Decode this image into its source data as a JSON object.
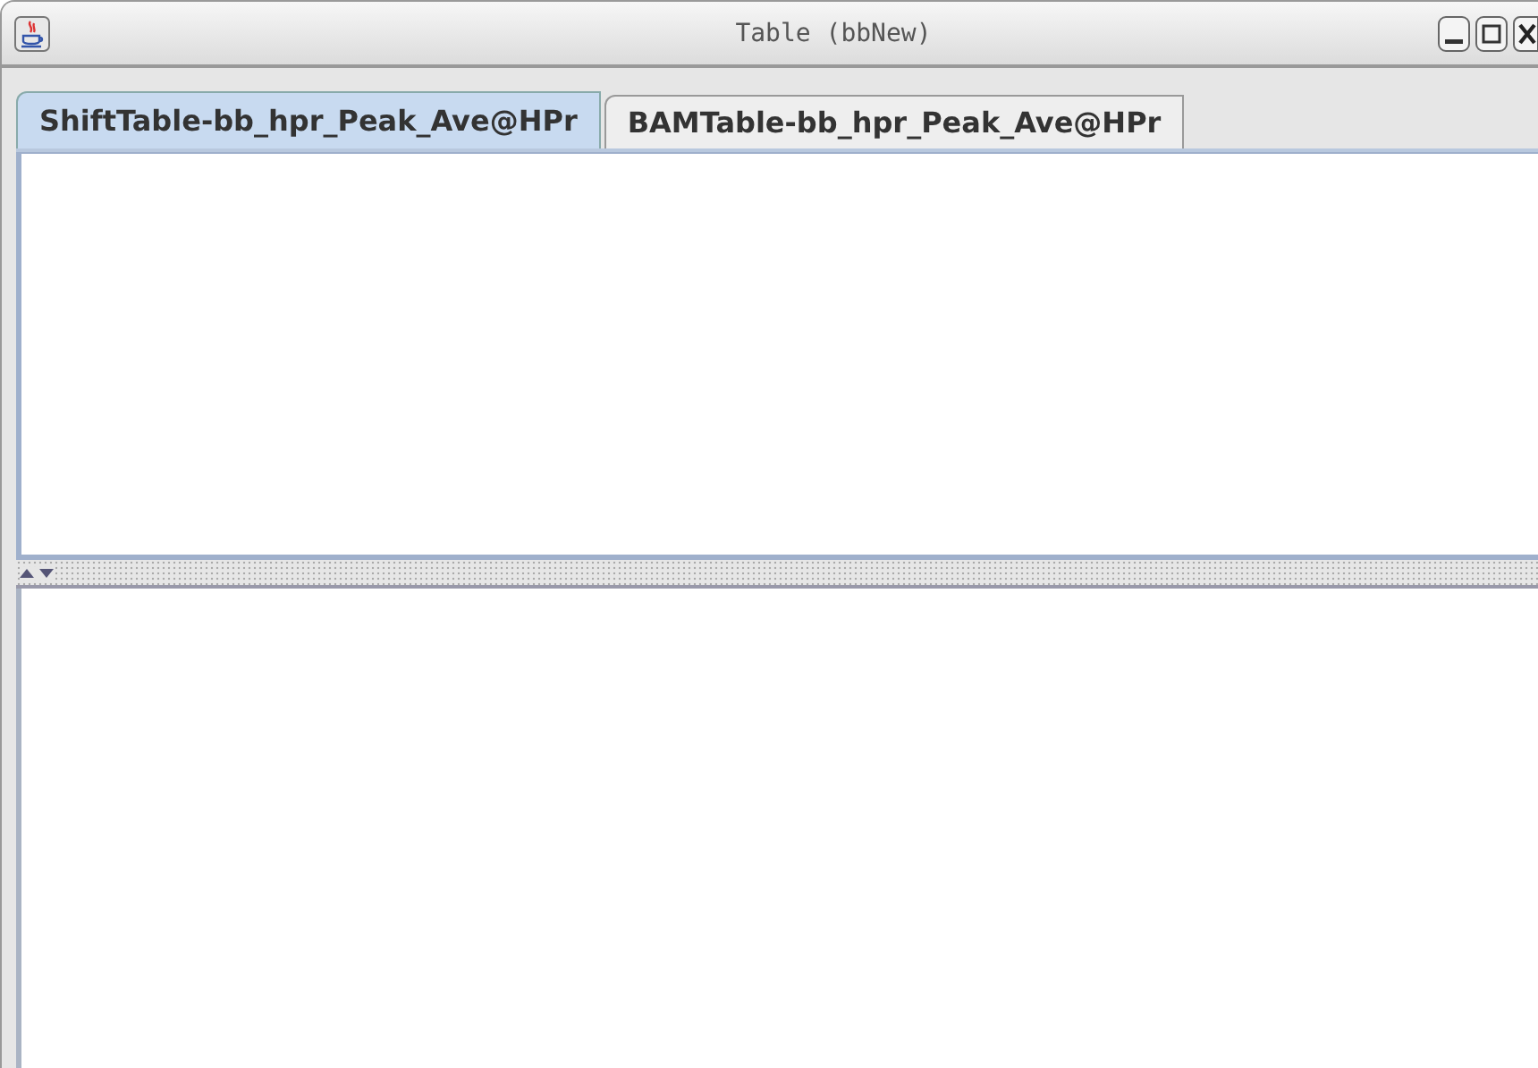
{
  "window": {
    "title": "Table (bbNew)"
  },
  "tabs": [
    {
      "label": "ShiftTable-bb_hpr_Peak_Ave@HPr",
      "selected": true
    },
    {
      "label": "BAMTable-bb_hpr_Peak_Ave@HPr",
      "selected": false
    }
  ]
}
